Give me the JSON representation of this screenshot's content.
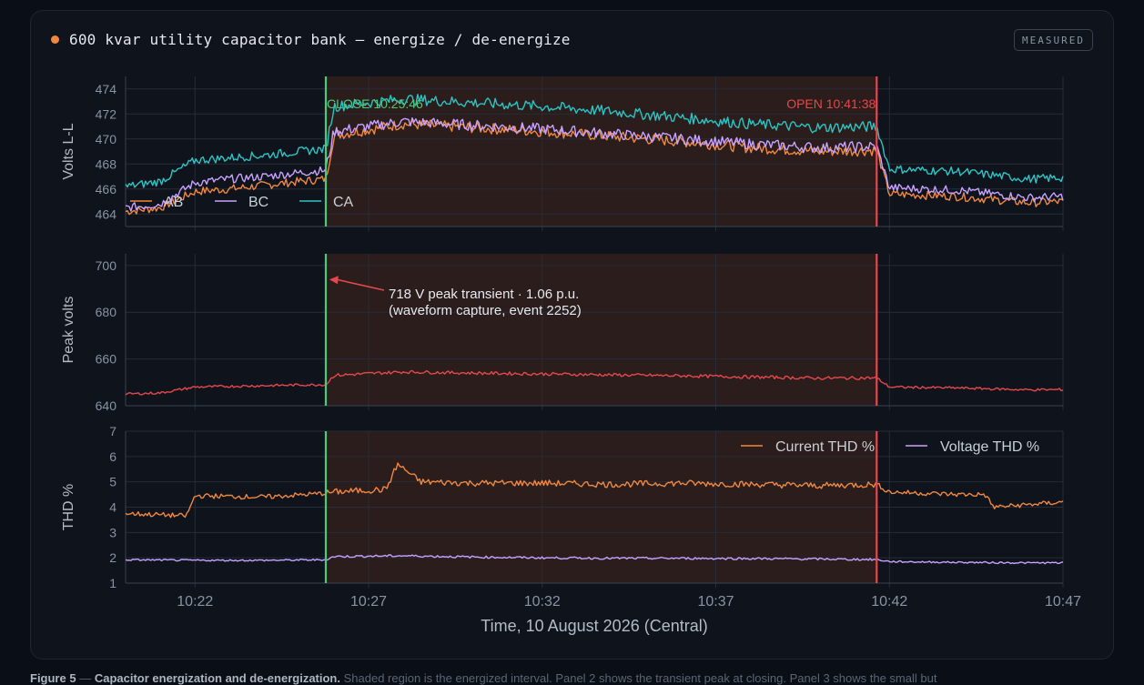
{
  "header": {
    "title": "600 kvar utility capacitor bank — energize / de-energize",
    "badge": "MEASURED",
    "dot_color": "#f0883e"
  },
  "caption": {
    "label": "Figure 5",
    "title": "Capacitor energization and de-energization.",
    "text": "Shaded region is the energized interval. Panel 2 shows the transient peak at closing. Panel 3 shows the small but"
  },
  "colors": {
    "AB": "#f0883e",
    "BC": "#c8a2ff",
    "CA": "#2bc4c4",
    "peak": "#e5484d",
    "close": "#4ec97a",
    "open": "#e5484d",
    "shade": "#2a1d1b"
  },
  "chart_data": {
    "type": "line",
    "xlabel": "Time, 10 August 2026 (Central)",
    "x_ticks": [
      "10:22",
      "10:27",
      "10:32",
      "10:37",
      "10:42",
      "10:47"
    ],
    "x_range": [
      "10:20",
      "10:47"
    ],
    "energized_interval": [
      "10:25:46",
      "10:41:38"
    ],
    "events": [
      {
        "name": "close",
        "label": "CLOSE 10:25:46",
        "time": "10:25:46"
      },
      {
        "name": "open",
        "label": "OPEN 10:41:38",
        "time": "10:41:38"
      }
    ],
    "panels": [
      {
        "ylabel": "Volts L-L",
        "ylim": [
          463,
          475
        ],
        "yticks": [
          464,
          466,
          468,
          470,
          472,
          474
        ],
        "legend": "bottom-left",
        "series": [
          {
            "name": "AB",
            "color_key": "AB",
            "times": [
              "10:20",
              "10:21",
              "10:22",
              "10:23",
              "10:24",
              "10:25",
              "10:25:46",
              "10:26",
              "10:28",
              "10:30",
              "10:32",
              "10:34",
              "10:36",
              "10:38",
              "10:40",
              "10:41:38",
              "10:42",
              "10:44",
              "10:46",
              "10:47"
            ],
            "values": [
              464.2,
              464.5,
              465.8,
              466.0,
              466.3,
              466.6,
              466.8,
              470.3,
              471.2,
              470.9,
              470.6,
              470.2,
              469.8,
              469.3,
              469.0,
              469.1,
              465.6,
              465.4,
              464.9,
              465.0
            ]
          },
          {
            "name": "BC",
            "color_key": "BC",
            "times": [
              "10:20",
              "10:21",
              "10:22",
              "10:23",
              "10:24",
              "10:25",
              "10:25:46",
              "10:26",
              "10:28",
              "10:30",
              "10:32",
              "10:34",
              "10:36",
              "10:38",
              "10:40",
              "10:41:38",
              "10:42",
              "10:44",
              "10:46",
              "10:47"
            ],
            "values": [
              464.5,
              464.8,
              466.5,
              466.8,
              467.0,
              467.3,
              467.5,
              470.6,
              471.4,
              471.1,
              470.8,
              470.4,
              470.0,
              469.6,
              469.3,
              469.4,
              466.1,
              465.9,
              465.3,
              465.4
            ]
          },
          {
            "name": "CA",
            "color_key": "CA",
            "times": [
              "10:20",
              "10:21",
              "10:22",
              "10:23",
              "10:24",
              "10:25",
              "10:25:46",
              "10:26",
              "10:28",
              "10:30",
              "10:32",
              "10:34",
              "10:36",
              "10:38",
              "10:40",
              "10:41:38",
              "10:42",
              "10:44",
              "10:46",
              "10:47"
            ],
            "values": [
              466.2,
              466.6,
              468.3,
              468.5,
              468.7,
              469.0,
              469.2,
              472.6,
              473.2,
              472.9,
              472.6,
              472.2,
              471.7,
              471.2,
              470.9,
              471.0,
              467.6,
              467.4,
              466.8,
              466.9
            ]
          }
        ]
      },
      {
        "ylabel": "Peak volts",
        "ylim": [
          640,
          705
        ],
        "yticks": [
          640,
          660,
          680,
          700
        ],
        "annotation": {
          "text_1": "718 V peak transient · 1.06 p.u.",
          "text_2": "(waveform capture, event 2252)",
          "time": "10:26",
          "value": 694
        },
        "series": [
          {
            "name": "Peak",
            "color_key": "peak",
            "times": [
              "10:20",
              "10:21",
              "10:22",
              "10:23",
              "10:24",
              "10:25",
              "10:25:46",
              "10:26",
              "10:28",
              "10:30",
              "10:32",
              "10:34",
              "10:36",
              "10:38",
              "10:40",
              "10:41:38",
              "10:42",
              "10:44",
              "10:46",
              "10:47"
            ],
            "values": [
              645.0,
              645.5,
              648.0,
              648.3,
              648.6,
              648.9,
              649.0,
              653.0,
              654.5,
              654.0,
              653.6,
              653.2,
              652.8,
              652.3,
              651.8,
              651.9,
              648.0,
              647.6,
              646.8,
              646.9
            ]
          }
        ]
      },
      {
        "ylabel": "THD %",
        "ylim": [
          1,
          7
        ],
        "yticks": [
          1,
          2,
          3,
          4,
          5,
          6,
          7
        ],
        "legend": "top-right",
        "series": [
          {
            "name": "Current THD %",
            "color_key": "AB",
            "times": [
              "10:20",
              "10:21",
              "10:21:45",
              "10:22",
              "10:24",
              "10:25:46",
              "10:26",
              "10:27:30",
              "10:27:50",
              "10:28:30",
              "10:30",
              "10:32",
              "10:34",
              "10:36",
              "10:38",
              "10:40",
              "10:41:38",
              "10:42",
              "10:44",
              "10:44:45",
              "10:45",
              "10:46",
              "10:47"
            ],
            "values": [
              3.75,
              3.7,
              3.65,
              4.45,
              4.4,
              4.55,
              4.6,
              4.7,
              5.7,
              5.0,
              4.95,
              4.95,
              4.9,
              4.95,
              4.9,
              4.85,
              4.9,
              4.6,
              4.5,
              4.5,
              4.0,
              4.1,
              4.2
            ]
          },
          {
            "name": "Voltage THD %",
            "color_key": "BC",
            "times": [
              "10:20",
              "10:22",
              "10:24",
              "10:25:46",
              "10:26",
              "10:28",
              "10:30",
              "10:32",
              "10:34",
              "10:36",
              "10:38",
              "10:40",
              "10:41:38",
              "10:42",
              "10:44",
              "10:46",
              "10:47"
            ],
            "values": [
              1.92,
              1.9,
              1.9,
              1.92,
              2.05,
              2.08,
              2.03,
              2.0,
              1.98,
              1.98,
              1.97,
              1.95,
              1.93,
              1.85,
              1.82,
              1.8,
              1.8
            ]
          }
        ]
      }
    ]
  }
}
